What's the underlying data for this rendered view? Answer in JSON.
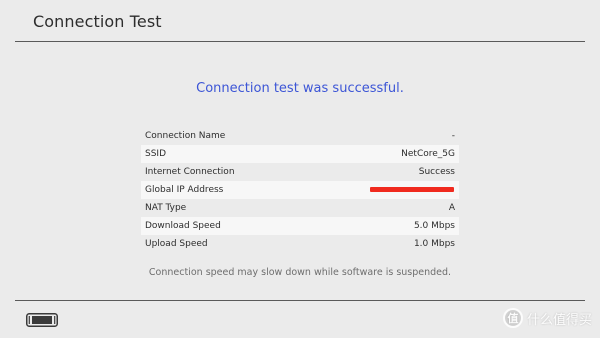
{
  "header": {
    "title": "Connection Test"
  },
  "result": {
    "message": "Connection test was successful.",
    "color": "#3c55d6"
  },
  "info": {
    "rows": [
      {
        "label": "Connection Name",
        "value": "-"
      },
      {
        "label": "SSID",
        "value": "NetCore_5G"
      },
      {
        "label": "Internet Connection",
        "value": "Success"
      },
      {
        "label": "Global IP Address",
        "value": "",
        "redacted": true
      },
      {
        "label": "NAT Type",
        "value": "A"
      },
      {
        "label": "Download Speed",
        "value": "5.0 Mbps"
      },
      {
        "label": "Upload Speed",
        "value": "1.0 Mbps"
      }
    ]
  },
  "note": "Connection speed may slow down while software is suspended.",
  "footer": {
    "console_icon": "handheld-console-icon",
    "watermark_text": "什么值得买",
    "watermark_badge": "值"
  },
  "colors": {
    "background": "#ebebeb",
    "divider": "#5a5a5a",
    "redaction": "#f02a1e"
  }
}
